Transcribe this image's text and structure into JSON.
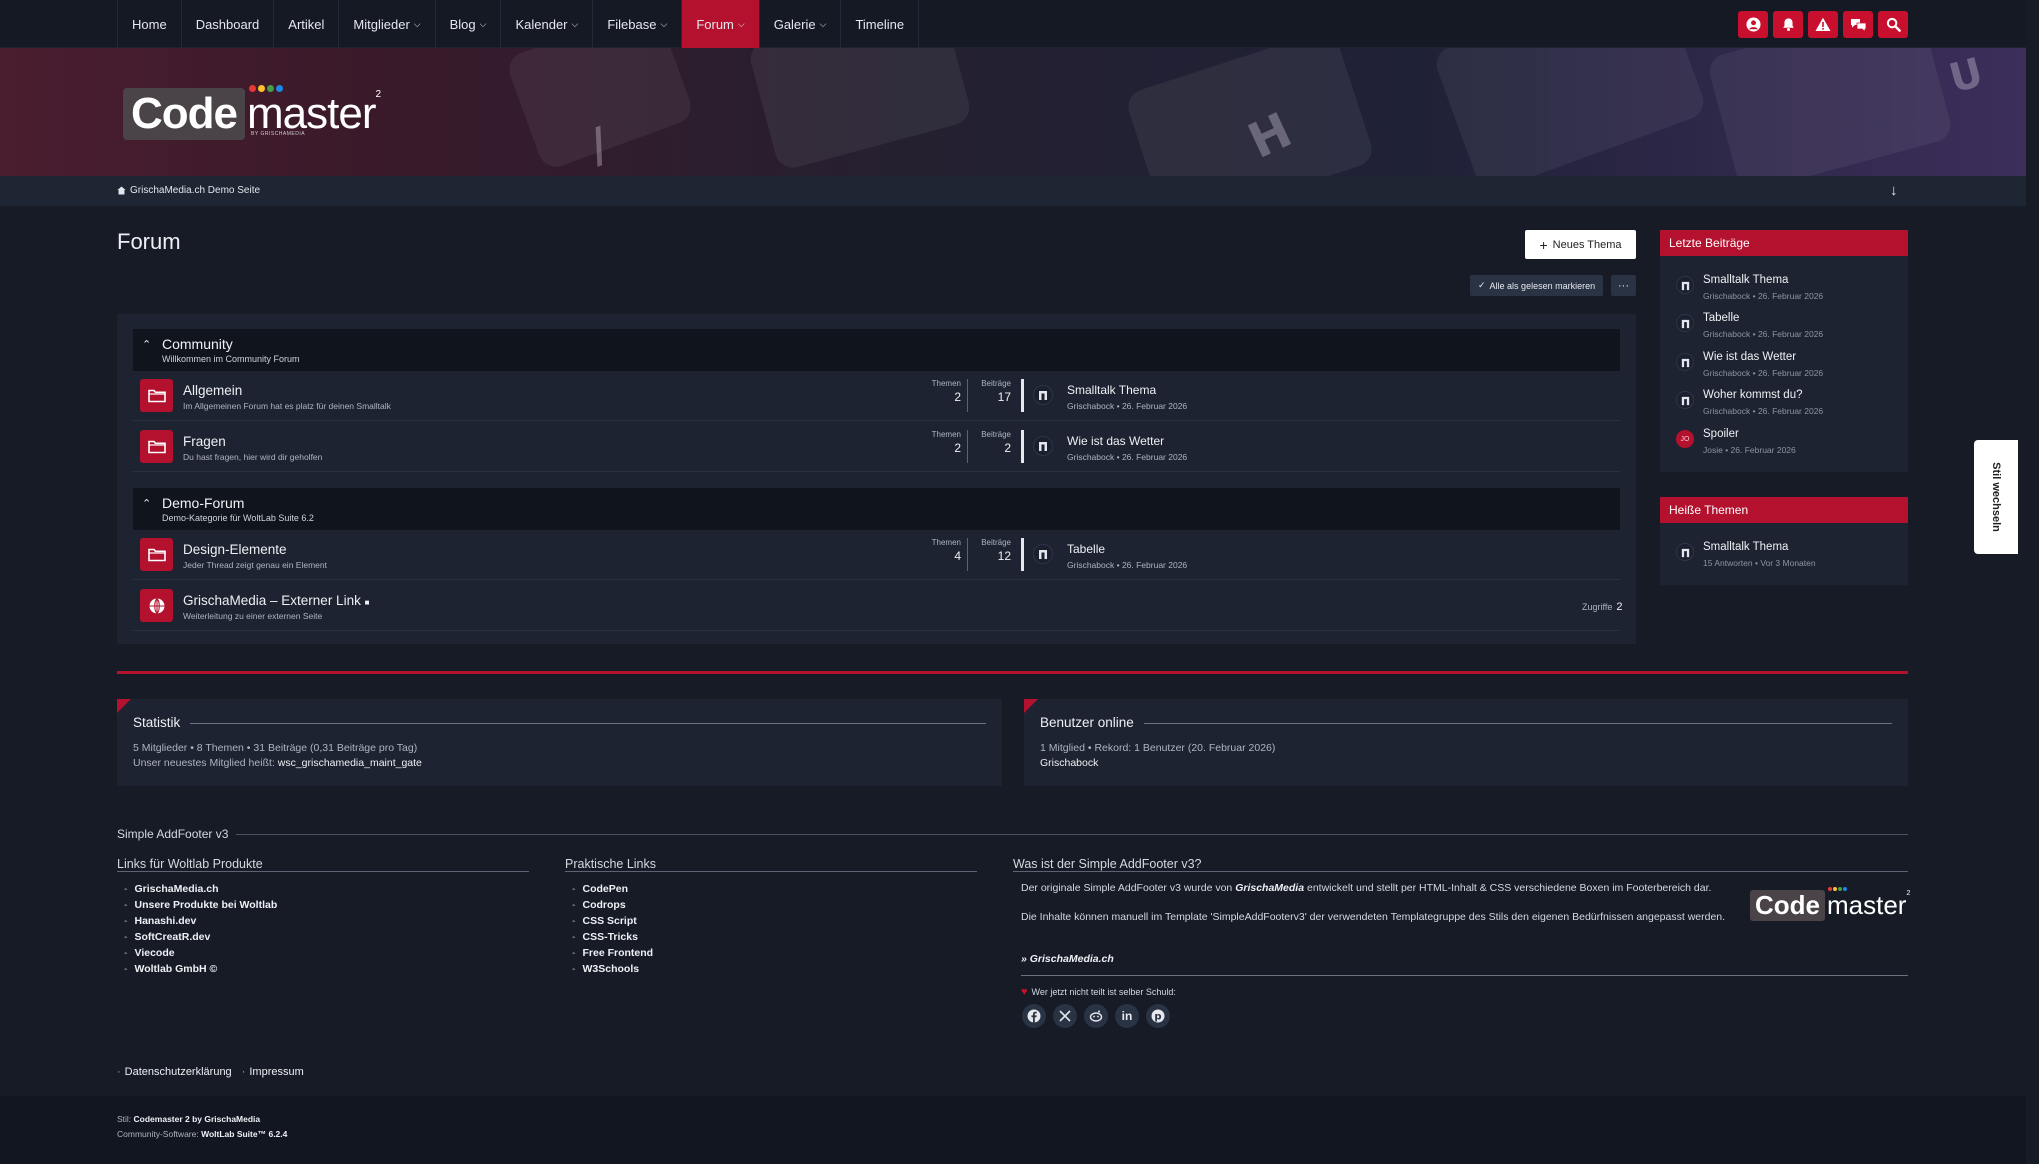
{
  "nav": {
    "items": [
      {
        "label": "Home",
        "dropdown": false
      },
      {
        "label": "Dashboard",
        "dropdown": false
      },
      {
        "label": "Artikel",
        "dropdown": false
      },
      {
        "label": "Mitglieder",
        "dropdown": true
      },
      {
        "label": "Blog",
        "dropdown": true
      },
      {
        "label": "Kalender",
        "dropdown": true
      },
      {
        "label": "Filebase",
        "dropdown": true
      },
      {
        "label": "Forum",
        "dropdown": true,
        "active": true
      },
      {
        "label": "Galerie",
        "dropdown": true
      },
      {
        "label": "Timeline",
        "dropdown": false
      }
    ],
    "icons": [
      "user-icon",
      "bell-icon",
      "warning-icon",
      "conversations-icon",
      "search-icon"
    ]
  },
  "logo": {
    "code": "Code",
    "master": "master",
    "sup": "2",
    "by": "BY GRISCHAMEDIA"
  },
  "breadcrumb": {
    "home": "GrischaMedia.ch Demo Seite"
  },
  "page": {
    "title": "Forum",
    "new_topic": "Neues Thema",
    "mark_read": "Alle als gelesen markieren"
  },
  "forum": {
    "labels": {
      "topics": "Themen",
      "posts": "Beiträge",
      "hits": "Zugriffe"
    },
    "categories": [
      {
        "title": "Community",
        "subtitle": "Willkommen im Community Forum",
        "boards": [
          {
            "name": "Allgemein",
            "desc": "Im Allgemeinen Forum hat es platz für deinen Smalltalk",
            "topics": "2",
            "posts": "17",
            "last_title": "Smalltalk Thema",
            "last_meta": "Grischabock • 26. Februar 2026"
          },
          {
            "name": "Fragen",
            "desc": "Du hast fragen, hier wird dir geholfen",
            "topics": "2",
            "posts": "2",
            "last_title": "Wie ist das Wetter",
            "last_meta": "Grischabock • 26. Februar 2026"
          }
        ]
      },
      {
        "title": "Demo-Forum",
        "subtitle": "Demo-Kategorie für WoltLab Suite 6.2",
        "boards": [
          {
            "name": "Design-Elemente",
            "desc": "Jeder Thread zeigt genau ein Element",
            "topics": "4",
            "posts": "12",
            "last_title": "Tabelle",
            "last_meta": "Grischabock • 26. Februar 2026"
          }
        ],
        "external": {
          "name": "GrischaMedia – Externer Link",
          "desc": "Weiterleitung zu einer externen Seite",
          "hits": "2"
        }
      }
    ]
  },
  "sidebar": {
    "recent": {
      "title": "Letzte Beiträge",
      "items": [
        {
          "title": "Smalltalk Thema",
          "meta": "Grischabock • 26. Februar 2026",
          "avatar": "logo"
        },
        {
          "title": "Tabelle",
          "meta": "Grischabock • 26. Februar 2026",
          "avatar": "logo"
        },
        {
          "title": "Wie ist das Wetter",
          "meta": "Grischabock • 26. Februar 2026",
          "avatar": "logo"
        },
        {
          "title": "Woher kommst du?",
          "meta": "Grischabock • 26. Februar 2026",
          "avatar": "logo"
        },
        {
          "title": "Spoiler",
          "meta": "Josie • 26. Februar 2026",
          "avatar": "JO"
        }
      ]
    },
    "hot": {
      "title": "Heiße Themen",
      "items": [
        {
          "title": "Smalltalk Thema",
          "meta": "15 Antworten • Vor 3 Monaten"
        }
      ]
    }
  },
  "style_switch": "Stil wechseln",
  "stats": {
    "title": "Statistik",
    "line1": "5 Mitglieder  •  8 Themen  •  31 Beiträge (0,31 Beiträge pro Tag)",
    "line2_prefix": "Unser neuestes Mitglied heißt: ",
    "newest_member": "wsc_grischamedia_maint_gate"
  },
  "online": {
    "title": "Benutzer online",
    "line1": "1 Mitglied  •  Rekord: 1 Benutzer (20. Februar 2026)",
    "users": "Grischabock"
  },
  "addfooter": {
    "title": "Simple AddFooter v3",
    "col1": {
      "title": "Links für Woltlab Produkte",
      "links": [
        "GrischaMedia.ch",
        "Unsere Produkte bei Woltlab",
        "Hanashi.dev",
        "SoftCreatR.dev",
        "Viecode",
        "Woltlab GmbH ©"
      ]
    },
    "col2": {
      "title": "Praktische Links",
      "links": [
        "CodePen",
        "Codrops",
        "CSS Script",
        "CSS-Tricks",
        "Free Frontend",
        "W3Schools"
      ]
    },
    "col3": {
      "title": "Was ist der Simple AddFooter v3?",
      "p1_a": "Der originale Simple AddFooter v3 wurde von ",
      "p1_brand": "GrischaMedia",
      "p1_b": " entwickelt und stellt per HTML-Inhalt & CSS verschiedene Boxen im Footerbereich dar.",
      "p2": "Die Inhalte können manuell im Template 'SimpleAddFooterv3' der verwendeten Templategruppe des Stils den eigenen Bedürfnissen angepasst werden.",
      "link": "» GrischaMedia.ch",
      "share": "Wer jetzt nicht teilt ist selber Schuld:",
      "social": [
        "facebook-icon",
        "x-icon",
        "reddit-icon",
        "linkedin-icon",
        "pinterest-icon"
      ]
    }
  },
  "legal": {
    "privacy": "Datenschutzerklärung",
    "imprint": "Impressum"
  },
  "bottom": {
    "style_label": "Stil: ",
    "style_value": "Codemaster 2 by GrischaMedia",
    "software_label": "Community-Software: ",
    "software_value": "WoltLab Suite™ 6.2.4"
  },
  "colors": {
    "accent": "#b3112e",
    "background": "#161b26",
    "panel": "#1d2330"
  }
}
